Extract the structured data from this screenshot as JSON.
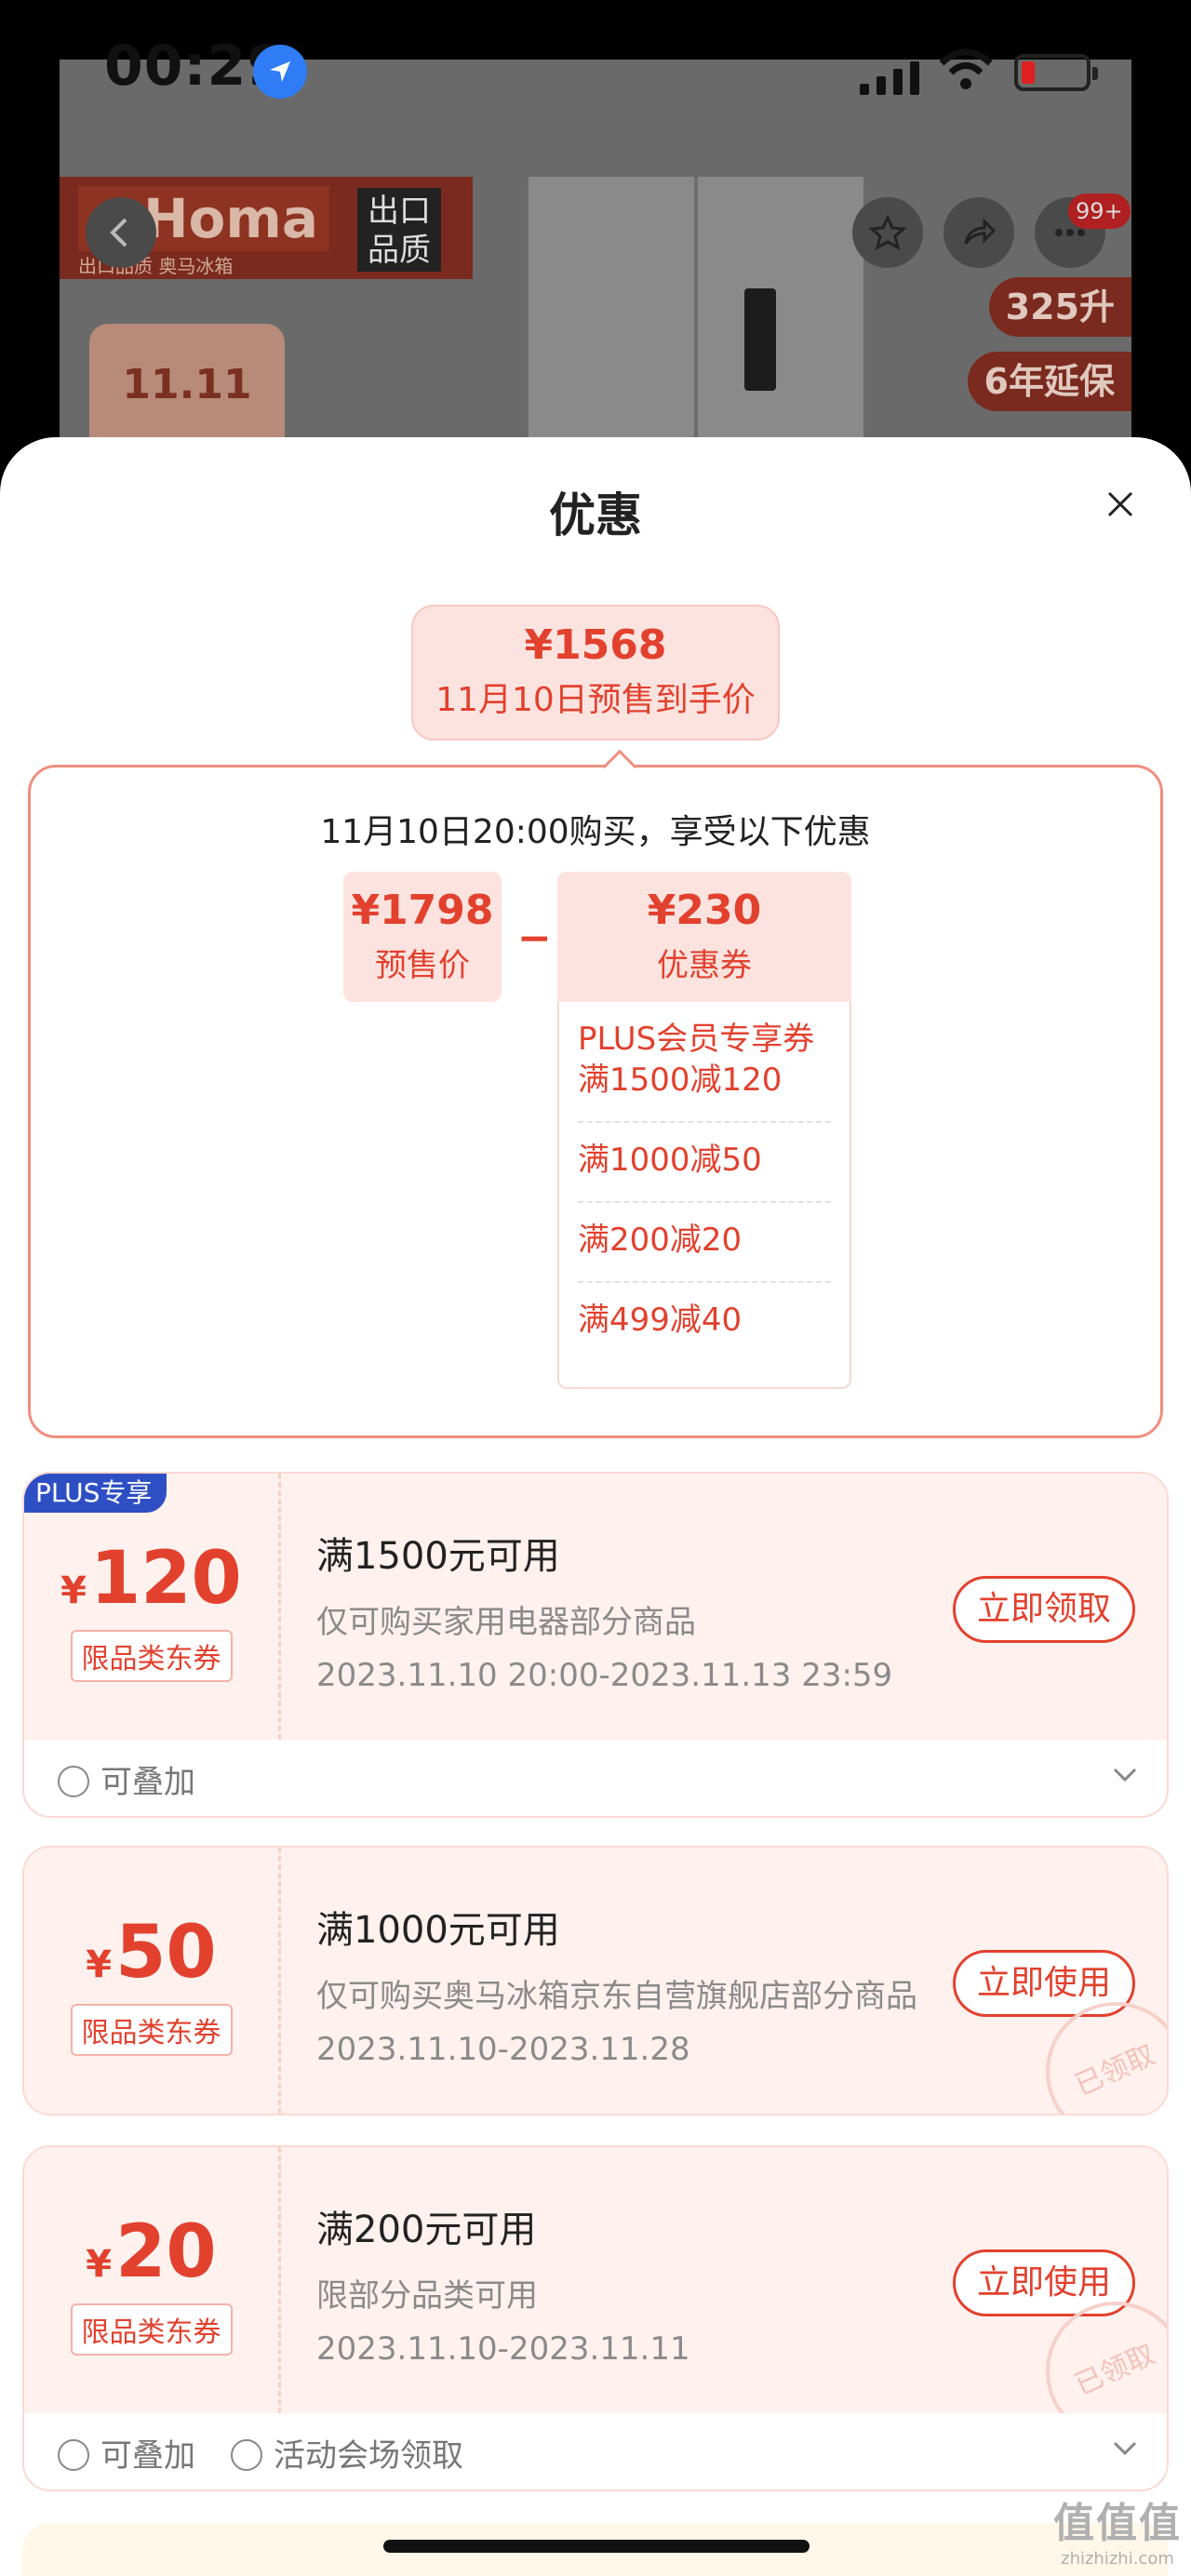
{
  "status_bar": {
    "time": "00:29"
  },
  "product_banner": {
    "brand": "Homa",
    "brand_sub": "出口品质 奥马冰箱",
    "export_tag": "出口品质",
    "badge": "99+",
    "promo": "11.11",
    "spec_tags": [
      "325升",
      "6年延保"
    ]
  },
  "sheet": {
    "title": "优惠"
  },
  "final_price": {
    "amount": "¥1568",
    "label": "11月10日预售到手价"
  },
  "calc": {
    "title": "11月10日20:00购买，享受以下优惠",
    "presale_amount": "¥1798",
    "presale_label": "预售价",
    "operator": "−",
    "coupon_amount": "¥230",
    "coupon_label": "优惠券",
    "coupon_rows": [
      "PLUS会员专享券 满1500减120",
      "满1000减50",
      "满200减20",
      "满499减40"
    ]
  },
  "coupons": [
    {
      "badge": "PLUS专享",
      "yen": "¥",
      "amount": "120",
      "type": "限品类东券",
      "condition": "满1500元可用",
      "desc": "仅可购买家用电器部分商品",
      "date": "2023.11.10 20:00-2023.11.13 23:59",
      "button": "立即领取",
      "tags": [
        "可叠加"
      ]
    },
    {
      "yen": "¥",
      "amount": "50",
      "type": "限品类东券",
      "condition": "满1000元可用",
      "desc": "仅可购买奥马冰箱京东自营旗舰店部分商品",
      "date": "2023.11.10-2023.11.28",
      "button": "立即使用",
      "stamp": "已领取"
    },
    {
      "yen": "¥",
      "amount": "20",
      "type": "限品类东券",
      "condition": "满200元可用",
      "desc": "限部分品类可用",
      "date": "2023.11.10-2023.11.11",
      "button": "立即使用",
      "stamp": "已领取",
      "tags": [
        "可叠加",
        "活动会场领取"
      ]
    }
  ],
  "watermark": {
    "text": "值值值",
    "site": "zhizhizhi.com"
  },
  "colors": {
    "accent": "#e2412e",
    "plus": "#2e4fc4",
    "coupon_bg": "#fff1ee"
  }
}
